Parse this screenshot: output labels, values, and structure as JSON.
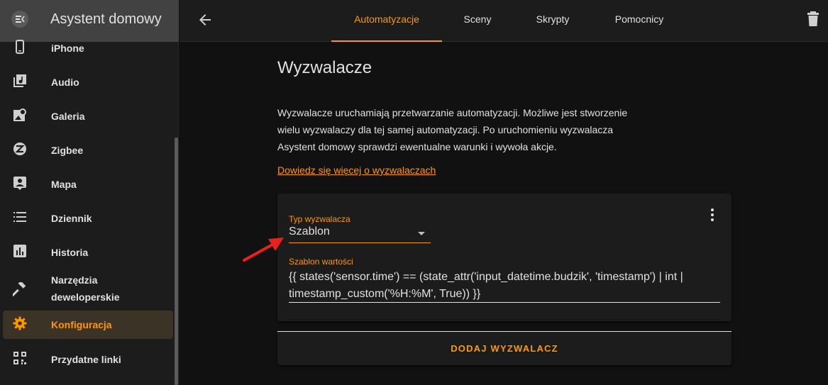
{
  "app": {
    "title": "Asystent domowy"
  },
  "sidebar": {
    "items": [
      {
        "label": "iPhone",
        "icon": "cellphone-icon"
      },
      {
        "label": "Audio",
        "icon": "music-library-icon"
      },
      {
        "label": "Galeria",
        "icon": "image-search-icon"
      },
      {
        "label": "Zigbee",
        "icon": "zigbee-icon"
      },
      {
        "label": "Mapa",
        "icon": "account-box-icon"
      },
      {
        "label": "Dziennik",
        "icon": "list-icon"
      },
      {
        "label": "Historia",
        "icon": "chart-box-icon"
      },
      {
        "label_line1": "Narzędzia",
        "label_line2": "deweloperskie",
        "icon": "hammer-icon"
      },
      {
        "label": "Konfiguracja",
        "icon": "cog-icon",
        "active": true
      },
      {
        "label": "Przydatne linki",
        "icon": "qrcode-icon"
      }
    ]
  },
  "tabs": [
    {
      "label": "Automatyzacje",
      "active": true
    },
    {
      "label": "Sceny"
    },
    {
      "label": "Skrypty"
    },
    {
      "label": "Pomocnicy"
    }
  ],
  "main": {
    "title": "Wyzwalacze",
    "description": "Wyzwalacze uruchamiają przetwarzanie automatyzacji. Możliwe jest stworzenie wielu wyzwalaczy dla tej samej automatyzacji. Po uruchomieniu wyzwalacza Asystent domowy sprawdzi ewentualne warunki i wywoła akcje.",
    "learn_more": "Dowiedz się więcej o wyzwalaczach",
    "trigger": {
      "type_label": "Typ wyzwalacza",
      "type_value": "Szablon",
      "template_label": "Szablon wartości",
      "template_value": "{{ states('sensor.time') == (state_attr('input_datetime.budzik', 'timestamp') | int | timestamp_custom('%H:%M', True)) }}"
    },
    "add_trigger": "DODAJ WYZWALACZ"
  },
  "colors": {
    "accent": "#ff9800",
    "annotation_arrow": "#e8211d"
  }
}
